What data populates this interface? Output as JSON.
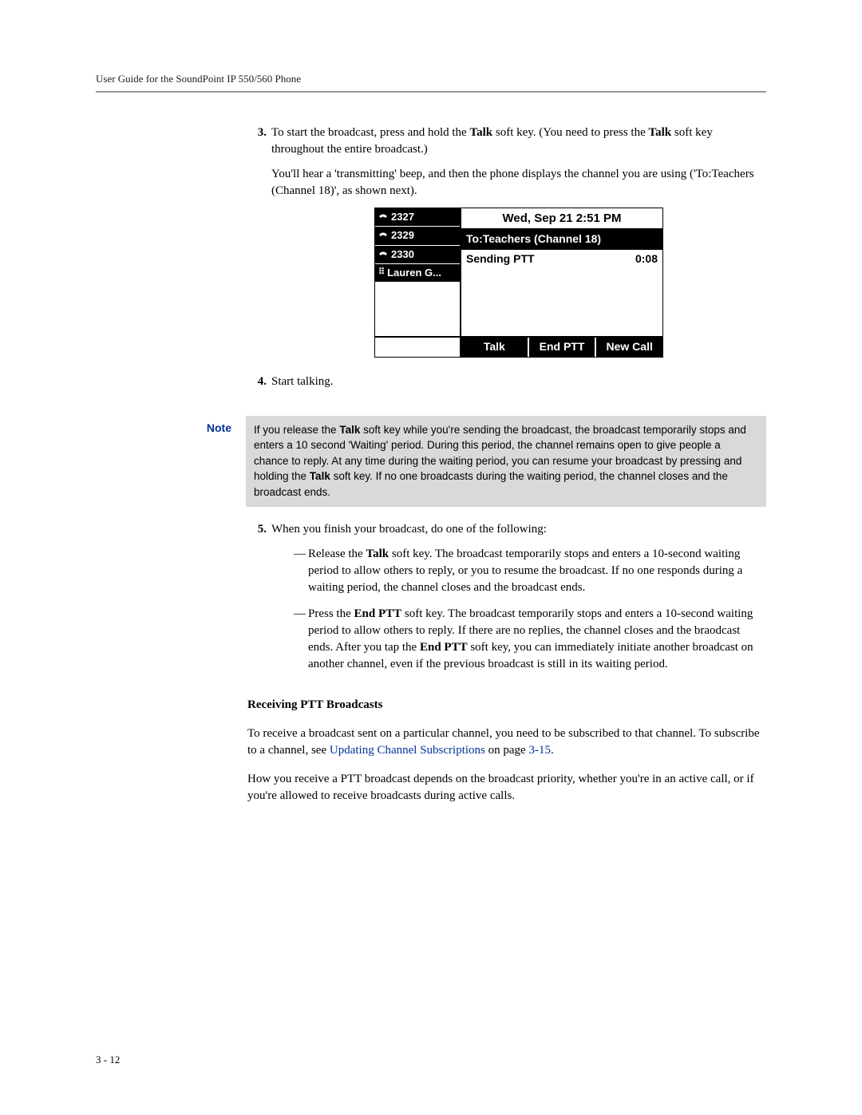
{
  "header": {
    "title": "User Guide for the SoundPoint IP 550/560 Phone"
  },
  "steps": {
    "s3": {
      "num": "3.",
      "p1a": "To start the broadcast, press and hold the ",
      "talk1": "Talk",
      "p1b": " soft key. (You need to press the ",
      "talk2": "Talk",
      "p1c": " soft key throughout the entire broadcast.)",
      "p2": "You'll hear a 'transmitting' beep, and then the phone displays the channel you are using ('To:Teachers (Channel 18)', as shown next)."
    },
    "s4": {
      "num": "4.",
      "text": "Start talking."
    },
    "s5": {
      "num": "5.",
      "lead": "When you finish your broadcast, do one of the following:",
      "d1a": "Release the ",
      "d1talk": "Talk",
      "d1b": " soft key. The broadcast temporarily stops and enters a 10-second waiting period to allow others to reply, or you to resume the broadcast. If no one responds during a waiting period, the channel closes and the broadcast ends.",
      "d2a": "Press the ",
      "d2end": "End PTT",
      "d2b": " soft key. The broadcast temporarily stops and enters a 10-second waiting period to allow others to reply. If there are no replies, the channel closes and the braodcast ends. After you tap the ",
      "d2end2": "End PTT",
      "d2c": " soft key, you can immediately initiate another broadcast on another channel, even if the previous broadcast is still in its waiting period."
    }
  },
  "phone": {
    "lines": [
      "2327",
      "2329",
      "2330",
      "Lauren G..."
    ],
    "datetime": "Wed, Sep 21  2:51 PM",
    "to": "To:Teachers (Channel 18)",
    "sending": "Sending PTT",
    "timer": "0:08",
    "softkeys": [
      "Talk",
      "End PTT",
      "New Call"
    ]
  },
  "note": {
    "label": "Note",
    "t1": "If you release the ",
    "talk": "Talk",
    "t2": " soft key while you're sending the broadcast, the broadcast temporarily stops and enters a 10 second 'Waiting' period. During this period, the channel remains open to give people a chance to reply. At any time during the waiting period, you can resume your broadcast by pressing and holding the ",
    "talk2": "Talk",
    "t3": " soft key. If no one broadcasts during the waiting period, the channel closes and the broadcast ends."
  },
  "receiving": {
    "heading": "Receiving PTT Broadcasts",
    "p1a": "To receive a broadcast sent on a particular channel, you need to be subscribed to that channel. To subscribe to a channel, see ",
    "link": "Updating Channel Subscriptions",
    "p1b": " on page ",
    "pageref": "3-15",
    "p1c": ".",
    "p2": "How you receive a PTT broadcast depends on the broadcast priority, whether you're in an active call, or if you're allowed to receive broadcasts during active calls."
  },
  "footer": {
    "pagenum": "3 - 12"
  }
}
